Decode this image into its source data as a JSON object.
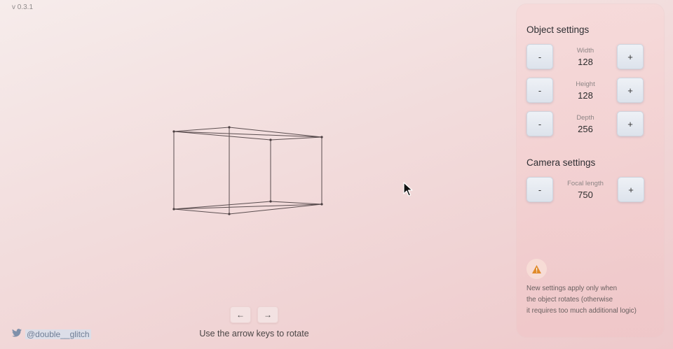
{
  "app": {
    "version": "v 0.3.1"
  },
  "controls": {
    "rotate_left_label": "←",
    "rotate_right_label": "→",
    "hint": "Use the arrow keys to rotate"
  },
  "footer": {
    "twitter_handle": "@double__glitch"
  },
  "object_settings": {
    "title": "Object settings",
    "fields": [
      {
        "label": "Width",
        "value": "128",
        "decrement": "-",
        "increment": "+"
      },
      {
        "label": "Height",
        "value": "128",
        "decrement": "-",
        "increment": "+"
      },
      {
        "label": "Depth",
        "value": "256",
        "decrement": "-",
        "increment": "+"
      }
    ]
  },
  "camera_settings": {
    "title": "Camera settings",
    "fields": [
      {
        "label": "Focal length",
        "value": "750",
        "decrement": "-",
        "increment": "+"
      }
    ]
  },
  "notice": {
    "icon": "warning-icon",
    "lines": [
      "New settings apply only when",
      "the object rotates (otherwise",
      "it requires too much additional logic)"
    ]
  },
  "colors": {
    "background_start": "#f6eceb",
    "background_end": "#eec9cb",
    "button_face": "#e6ebf2",
    "wireframe": "#5a4d4f",
    "warning": "#e08a2a"
  }
}
